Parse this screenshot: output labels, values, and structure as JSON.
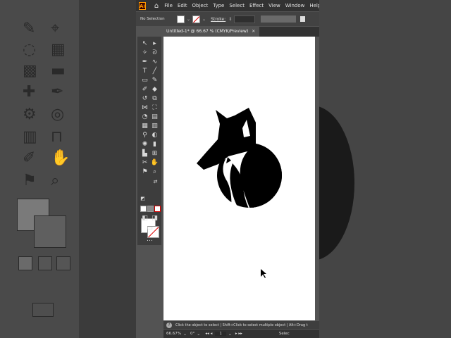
{
  "app": {
    "logo_text": "Ai",
    "home_icon": "home-icon",
    "menu": [
      "File",
      "Edit",
      "Object",
      "Type",
      "Select",
      "Effect",
      "View",
      "Window",
      "Help"
    ]
  },
  "control_bar": {
    "selection_text": "No Selection",
    "stroke_label": "Stroke:"
  },
  "document": {
    "tab_title": "Untitled-1* @ 66.67 % (CMYK/Preview)",
    "close_glyph": "✕"
  },
  "status": {
    "hint_text": "Click the object to select  |  Shift+Click to select multiple object  |  Alt+Drag t",
    "zoom": "66.67%",
    "rotation": "0°",
    "artboard_number": "1",
    "right_label": "Selec"
  },
  "colors": {
    "fox": "#000000",
    "accent_orange": "#ff9a00",
    "none_red": "#dd0000"
  }
}
